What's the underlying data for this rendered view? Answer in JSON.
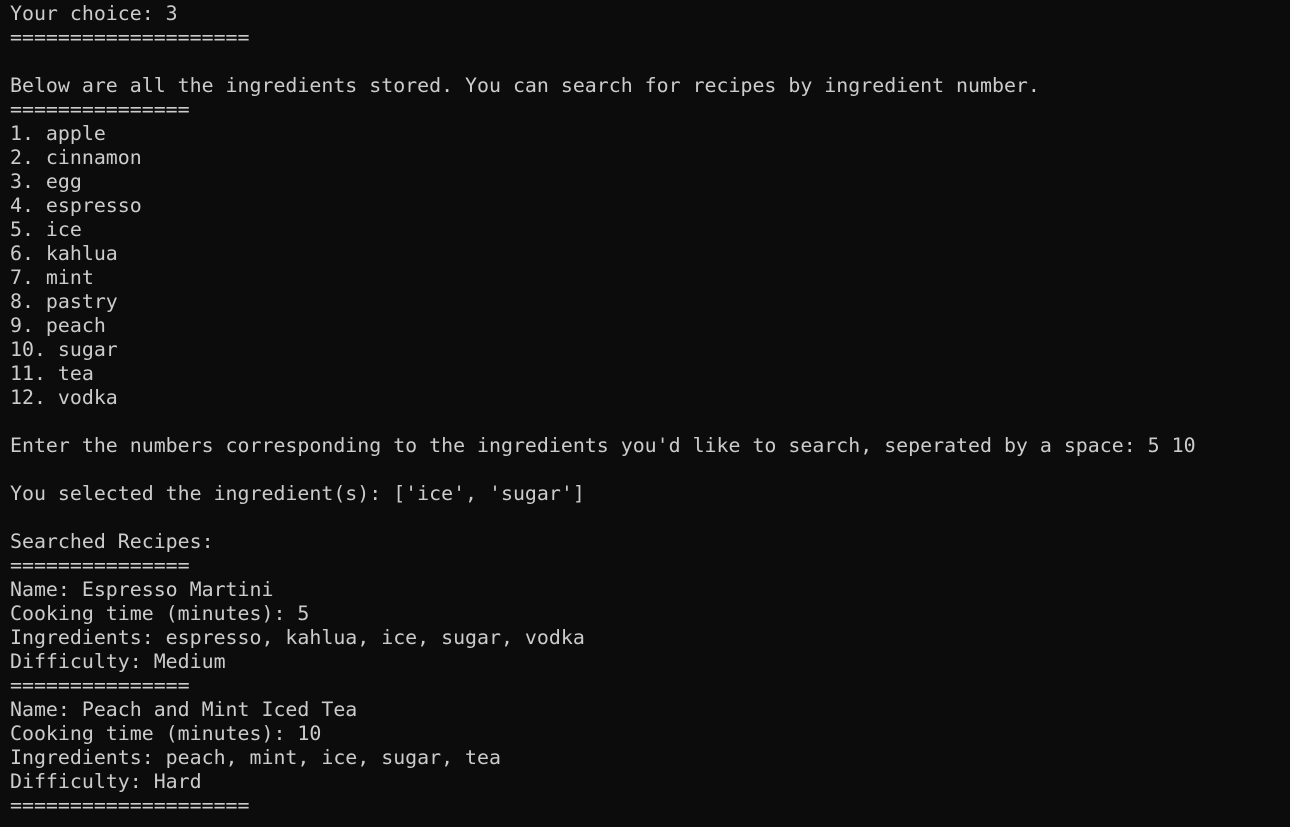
{
  "terminal": {
    "lines": [
      "Your choice: 3",
      "====================",
      "",
      "Below are all the ingredients stored. You can search for recipes by ingredient number.",
      "===============",
      "1. apple",
      "2. cinnamon",
      "3. egg",
      "4. espresso",
      "5. ice",
      "6. kahlua",
      "7. mint",
      "8. pastry",
      "9. peach",
      "10. sugar",
      "11. tea",
      "12. vodka",
      "",
      "Enter the numbers corresponding to the ingredients you'd like to search, seperated by a space: 5 10",
      "",
      "You selected the ingredient(s): ['ice', 'sugar']",
      "",
      "Searched Recipes:",
      "===============",
      "Name: Espresso Martini",
      "Cooking time (minutes): 5",
      "Ingredients: espresso, kahlua, ice, sugar, vodka",
      "Difficulty: Medium",
      "===============",
      "Name: Peach and Mint Iced Tea",
      "Cooking time (minutes): 10",
      "Ingredients: peach, mint, ice, sugar, tea",
      "Difficulty: Hard",
      "===================="
    ]
  }
}
